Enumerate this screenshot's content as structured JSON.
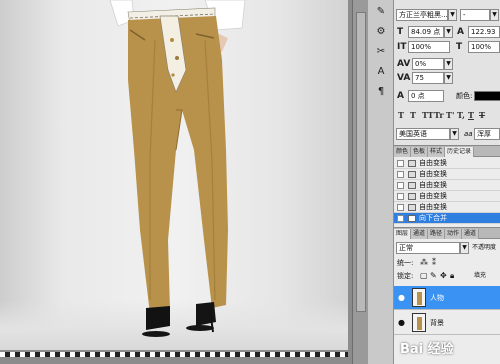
{
  "character": {
    "font_family": "方正兰亭粗黑...",
    "font_style": "-",
    "font_size": "84.09 点",
    "leading": "122.93",
    "vertical_scale": "100%",
    "horizontal_scale": "100%",
    "tracking": "0%",
    "kerning": "75",
    "baseline_shift": "0 点",
    "color_label": "颜色:",
    "color_value": "#000000",
    "type_buttons": [
      "T",
      "T",
      "TT",
      "Tr",
      "T'",
      "T,",
      "T",
      "T"
    ],
    "language": "美国英语",
    "antialias_icon": "aa",
    "antialias_value": "浑厚"
  },
  "history": {
    "tabs": [
      "颜色",
      "色板",
      "样式",
      "历史记录"
    ],
    "active_tab": "历史记录",
    "items": [
      {
        "label": "自由变换",
        "selected": false
      },
      {
        "label": "自由变换",
        "selected": false
      },
      {
        "label": "自由变换",
        "selected": false
      },
      {
        "label": "自由变换",
        "selected": false
      },
      {
        "label": "自由变换",
        "selected": false
      },
      {
        "label": "向下合并",
        "selected": true
      }
    ]
  },
  "layers": {
    "tabs": [
      "图层",
      "通道",
      "路径",
      "动作",
      "通道"
    ],
    "active_tab": "图层",
    "blend_mode": "正常",
    "opacity_label": "不透明度",
    "unify_label": "统一:",
    "lock_label": "锁定:",
    "fill_label": "填充",
    "items": [
      {
        "name": "人物",
        "selected": true
      },
      {
        "name": "背景",
        "selected": false
      }
    ]
  },
  "watermark": "Bai 经验",
  "colors": {
    "selection": "#2e7fe0",
    "pants": "#b8924a",
    "panel_bg": "#ececec"
  }
}
